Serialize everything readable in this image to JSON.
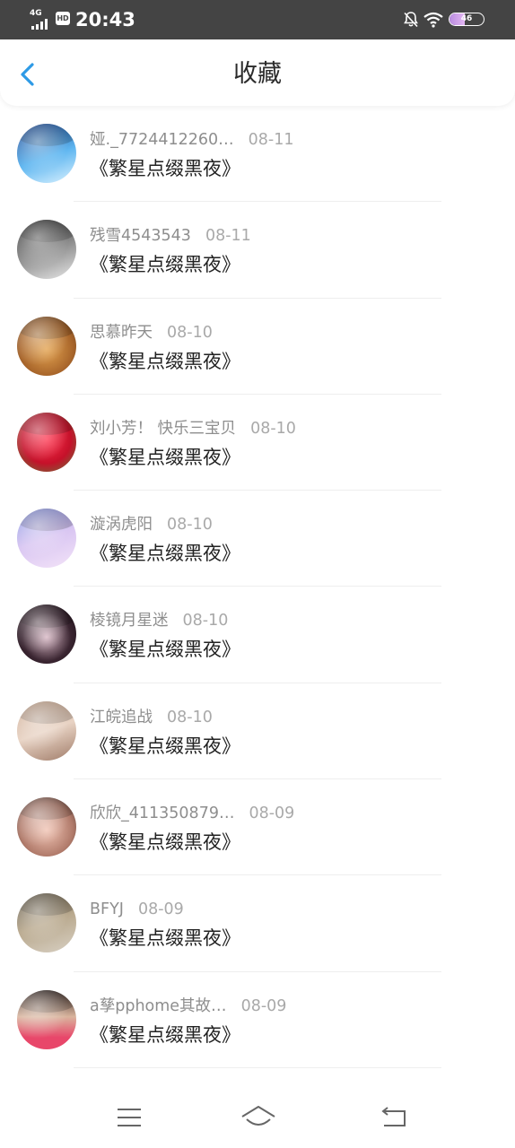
{
  "status_bar": {
    "network": "4G",
    "hd_badge": "HD",
    "time": "20:43",
    "battery_level": "46",
    "battery_fraction": 0.46
  },
  "header": {
    "title": "收藏",
    "back_icon": "chevron-left-icon",
    "accent_color": "#2e9ae6"
  },
  "items": [
    {
      "name": "娅._7724412260…",
      "date": "08-11",
      "title": "《繁星点缀黑夜》",
      "avatar_bg": "linear-gradient(160deg,#0d3a8c,#5fb6f0 55%,#d9f1ff)"
    },
    {
      "name": "残雪4543543",
      "date": "08-11",
      "title": "《繁星点缀黑夜》",
      "avatar_bg": "linear-gradient(160deg,#222222,#8a8a8a 50%,#e6e6e6)"
    },
    {
      "name": "思慕昨天",
      "date": "08-10",
      "title": "《繁星点缀黑夜》",
      "avatar_bg": "radial-gradient(circle at 50% 55%,#e4a451,#a8652a 60%,#5b3a20)"
    },
    {
      "name": "刘小芳！ 快乐三宝贝",
      "date": "08-10",
      "title": "《繁星点缀黑夜》",
      "avatar_bg": "radial-gradient(circle at 50% 45%,#ff2f4a,#c5112a 55%,#5d7d3a)"
    },
    {
      "name": "漩涡虎阳",
      "date": "08-10",
      "title": "《繁星点缀黑夜》",
      "avatar_bg": "linear-gradient(160deg,#7f8fe0,#d9c6f2 50%,#f3e3f8)"
    },
    {
      "name": "棱镜月星迷",
      "date": "08-10",
      "title": "《繁星点缀黑夜》",
      "avatar_bg": "radial-gradient(circle at 50% 55%,#d9b9c6,#3a2531 55%,#140b11)"
    },
    {
      "name": "江皖追战",
      "date": "08-10",
      "title": "《繁星点缀黑夜》",
      "avatar_bg": "linear-gradient(160deg,#caa68c,#e8d3c4 50%,#a07c69)"
    },
    {
      "name": "欣欣_411350879…",
      "date": "08-09",
      "title": "《繁星点缀黑夜》",
      "avatar_bg": "radial-gradient(circle at 50% 55%,#f1c4b4,#b07a6a 60%,#3b2a26)"
    },
    {
      "name": "BFYJ",
      "date": "08-09",
      "title": "《繁星点缀黑夜》",
      "avatar_bg": "linear-gradient(160deg,#5a5140,#b9a98e 50%,#d8d0c3)"
    },
    {
      "name": "a孳pphome其故…",
      "date": "08-09",
      "title": "《繁星点缀黑夜》",
      "avatar_bg": "linear-gradient(180deg,#3b2e2a,#d9b49d 45%,#e8476a 80%)"
    },
    {
      "name": "",
      "date": "",
      "title": "",
      "avatar_bg": "linear-gradient(180deg,#cccccc,#eeeeee)"
    }
  ],
  "nav_bar": {
    "menu_icon": "menu-icon",
    "home_icon": "home-icon",
    "back_icon": "back-arrow-icon"
  }
}
